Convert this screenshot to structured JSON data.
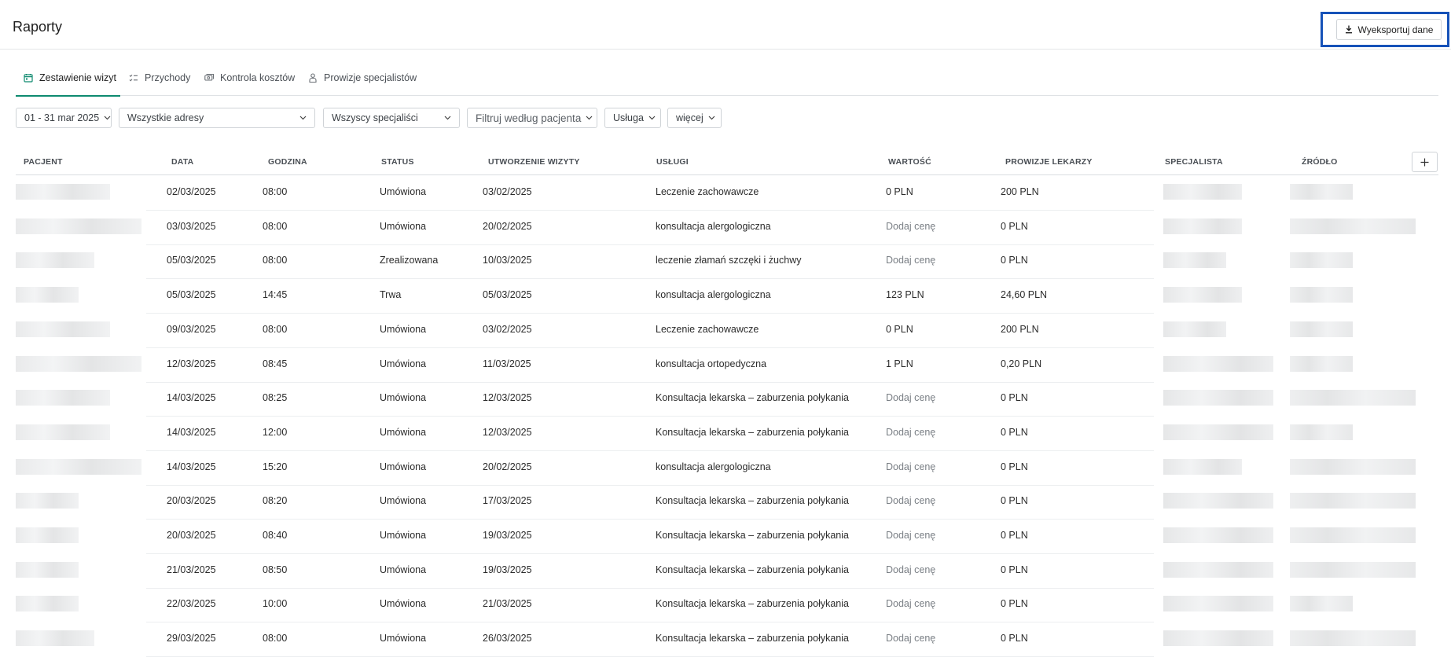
{
  "header": {
    "title": "Raporty",
    "export_label": "Wyeksportuj dane"
  },
  "tabs": [
    {
      "label": "Zestawienie wizyt",
      "icon": "calendar-icon",
      "active": true
    },
    {
      "label": "Przychody",
      "icon": "checklist-icon",
      "active": false
    },
    {
      "label": "Kontrola kosztów",
      "icon": "money-icon",
      "active": false
    },
    {
      "label": "Prowizje specjalistów",
      "icon": "person-icon",
      "active": false
    }
  ],
  "filters": {
    "date": "01 - 31 mar 2025",
    "address": "Wszystkie adresy",
    "specialists": "Wszyscy specjaliści",
    "patient_placeholder": "Filtruj według pacjenta",
    "service": "Usługa",
    "more": "więcej"
  },
  "table": {
    "columns": [
      "PACJENT",
      "DATA",
      "GODZINA",
      "STATUS",
      "UTWORZENIE WIZYTY",
      "USŁUGI",
      "WARTOŚĆ",
      "PROWIZJE LEKARZY",
      "SPECJALISTA",
      "ŹRÓDŁO"
    ],
    "rows": [
      {
        "date": "02/03/2025",
        "time": "08:00",
        "status": "Umówiona",
        "created": "03/02/2025",
        "service": "Leczenie zachowawcze",
        "value": "0 PLN",
        "commission": "200 PLN"
      },
      {
        "date": "03/03/2025",
        "time": "08:00",
        "status": "Umówiona",
        "created": "20/02/2025",
        "service": "konsultacja alergologiczna",
        "value": "Dodaj cenę",
        "commission": "0 PLN"
      },
      {
        "date": "05/03/2025",
        "time": "08:00",
        "status": "Zrealizowana",
        "created": "10/03/2025",
        "service": "leczenie złamań szczęki i żuchwy",
        "value": "Dodaj cenę",
        "commission": "0 PLN"
      },
      {
        "date": "05/03/2025",
        "time": "14:45",
        "status": "Trwa",
        "created": "05/03/2025",
        "service": "konsultacja alergologiczna",
        "value": "123 PLN",
        "commission": "24,60 PLN"
      },
      {
        "date": "09/03/2025",
        "time": "08:00",
        "status": "Umówiona",
        "created": "03/02/2025",
        "service": "Leczenie zachowawcze",
        "value": "0 PLN",
        "commission": "200 PLN"
      },
      {
        "date": "12/03/2025",
        "time": "08:45",
        "status": "Umówiona",
        "created": "11/03/2025",
        "service": "konsultacja ortopedyczna",
        "value": "1 PLN",
        "commission": "0,20 PLN"
      },
      {
        "date": "14/03/2025",
        "time": "08:25",
        "status": "Umówiona",
        "created": "12/03/2025",
        "service": "Konsultacja lekarska – zaburzenia połykania",
        "value": "Dodaj cenę",
        "commission": "0 PLN"
      },
      {
        "date": "14/03/2025",
        "time": "12:00",
        "status": "Umówiona",
        "created": "12/03/2025",
        "service": "Konsultacja lekarska – zaburzenia połykania",
        "value": "Dodaj cenę",
        "commission": "0 PLN"
      },
      {
        "date": "14/03/2025",
        "time": "15:20",
        "status": "Umówiona",
        "created": "20/02/2025",
        "service": "konsultacja alergologiczna",
        "value": "Dodaj cenę",
        "commission": "0 PLN"
      },
      {
        "date": "20/03/2025",
        "time": "08:20",
        "status": "Umówiona",
        "created": "17/03/2025",
        "service": "Konsultacja lekarska – zaburzenia połykania",
        "value": "Dodaj cenę",
        "commission": "0 PLN"
      },
      {
        "date": "20/03/2025",
        "time": "08:40",
        "status": "Umówiona",
        "created": "19/03/2025",
        "service": "Konsultacja lekarska – zaburzenia połykania",
        "value": "Dodaj cenę",
        "commission": "0 PLN"
      },
      {
        "date": "21/03/2025",
        "time": "08:50",
        "status": "Umówiona",
        "created": "19/03/2025",
        "service": "Konsultacja lekarska – zaburzenia połykania",
        "value": "Dodaj cenę",
        "commission": "0 PLN"
      },
      {
        "date": "22/03/2025",
        "time": "10:00",
        "status": "Umówiona",
        "created": "21/03/2025",
        "service": "Konsultacja lekarska – zaburzenia połykania",
        "value": "Dodaj cenę",
        "commission": "0 PLN"
      },
      {
        "date": "29/03/2025",
        "time": "08:00",
        "status": "Umówiona",
        "created": "26/03/2025",
        "service": "Konsultacja lekarska – zaburzenia połykania",
        "value": "Dodaj cenę",
        "commission": "0 PLN"
      }
    ]
  },
  "colors": {
    "accent": "#0e8a6f",
    "highlight_frame": "#1652b8",
    "muted_text": "#7a7f85"
  }
}
